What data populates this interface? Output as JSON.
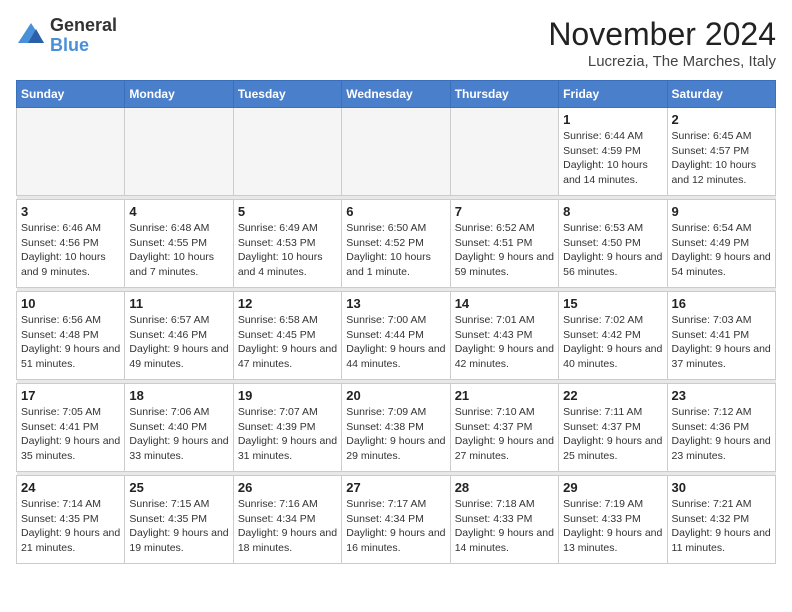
{
  "logo": {
    "general": "General",
    "blue": "Blue"
  },
  "header": {
    "month": "November 2024",
    "location": "Lucrezia, The Marches, Italy"
  },
  "weekdays": [
    "Sunday",
    "Monday",
    "Tuesday",
    "Wednesday",
    "Thursday",
    "Friday",
    "Saturday"
  ],
  "weeks": [
    [
      {
        "day": "",
        "info": ""
      },
      {
        "day": "",
        "info": ""
      },
      {
        "day": "",
        "info": ""
      },
      {
        "day": "",
        "info": ""
      },
      {
        "day": "",
        "info": ""
      },
      {
        "day": "1",
        "info": "Sunrise: 6:44 AM\nSunset: 4:59 PM\nDaylight: 10 hours and 14 minutes."
      },
      {
        "day": "2",
        "info": "Sunrise: 6:45 AM\nSunset: 4:57 PM\nDaylight: 10 hours and 12 minutes."
      }
    ],
    [
      {
        "day": "3",
        "info": "Sunrise: 6:46 AM\nSunset: 4:56 PM\nDaylight: 10 hours and 9 minutes."
      },
      {
        "day": "4",
        "info": "Sunrise: 6:48 AM\nSunset: 4:55 PM\nDaylight: 10 hours and 7 minutes."
      },
      {
        "day": "5",
        "info": "Sunrise: 6:49 AM\nSunset: 4:53 PM\nDaylight: 10 hours and 4 minutes."
      },
      {
        "day": "6",
        "info": "Sunrise: 6:50 AM\nSunset: 4:52 PM\nDaylight: 10 hours and 1 minute."
      },
      {
        "day": "7",
        "info": "Sunrise: 6:52 AM\nSunset: 4:51 PM\nDaylight: 9 hours and 59 minutes."
      },
      {
        "day": "8",
        "info": "Sunrise: 6:53 AM\nSunset: 4:50 PM\nDaylight: 9 hours and 56 minutes."
      },
      {
        "day": "9",
        "info": "Sunrise: 6:54 AM\nSunset: 4:49 PM\nDaylight: 9 hours and 54 minutes."
      }
    ],
    [
      {
        "day": "10",
        "info": "Sunrise: 6:56 AM\nSunset: 4:48 PM\nDaylight: 9 hours and 51 minutes."
      },
      {
        "day": "11",
        "info": "Sunrise: 6:57 AM\nSunset: 4:46 PM\nDaylight: 9 hours and 49 minutes."
      },
      {
        "day": "12",
        "info": "Sunrise: 6:58 AM\nSunset: 4:45 PM\nDaylight: 9 hours and 47 minutes."
      },
      {
        "day": "13",
        "info": "Sunrise: 7:00 AM\nSunset: 4:44 PM\nDaylight: 9 hours and 44 minutes."
      },
      {
        "day": "14",
        "info": "Sunrise: 7:01 AM\nSunset: 4:43 PM\nDaylight: 9 hours and 42 minutes."
      },
      {
        "day": "15",
        "info": "Sunrise: 7:02 AM\nSunset: 4:42 PM\nDaylight: 9 hours and 40 minutes."
      },
      {
        "day": "16",
        "info": "Sunrise: 7:03 AM\nSunset: 4:41 PM\nDaylight: 9 hours and 37 minutes."
      }
    ],
    [
      {
        "day": "17",
        "info": "Sunrise: 7:05 AM\nSunset: 4:41 PM\nDaylight: 9 hours and 35 minutes."
      },
      {
        "day": "18",
        "info": "Sunrise: 7:06 AM\nSunset: 4:40 PM\nDaylight: 9 hours and 33 minutes."
      },
      {
        "day": "19",
        "info": "Sunrise: 7:07 AM\nSunset: 4:39 PM\nDaylight: 9 hours and 31 minutes."
      },
      {
        "day": "20",
        "info": "Sunrise: 7:09 AM\nSunset: 4:38 PM\nDaylight: 9 hours and 29 minutes."
      },
      {
        "day": "21",
        "info": "Sunrise: 7:10 AM\nSunset: 4:37 PM\nDaylight: 9 hours and 27 minutes."
      },
      {
        "day": "22",
        "info": "Sunrise: 7:11 AM\nSunset: 4:37 PM\nDaylight: 9 hours and 25 minutes."
      },
      {
        "day": "23",
        "info": "Sunrise: 7:12 AM\nSunset: 4:36 PM\nDaylight: 9 hours and 23 minutes."
      }
    ],
    [
      {
        "day": "24",
        "info": "Sunrise: 7:14 AM\nSunset: 4:35 PM\nDaylight: 9 hours and 21 minutes."
      },
      {
        "day": "25",
        "info": "Sunrise: 7:15 AM\nSunset: 4:35 PM\nDaylight: 9 hours and 19 minutes."
      },
      {
        "day": "26",
        "info": "Sunrise: 7:16 AM\nSunset: 4:34 PM\nDaylight: 9 hours and 18 minutes."
      },
      {
        "day": "27",
        "info": "Sunrise: 7:17 AM\nSunset: 4:34 PM\nDaylight: 9 hours and 16 minutes."
      },
      {
        "day": "28",
        "info": "Sunrise: 7:18 AM\nSunset: 4:33 PM\nDaylight: 9 hours and 14 minutes."
      },
      {
        "day": "29",
        "info": "Sunrise: 7:19 AM\nSunset: 4:33 PM\nDaylight: 9 hours and 13 minutes."
      },
      {
        "day": "30",
        "info": "Sunrise: 7:21 AM\nSunset: 4:32 PM\nDaylight: 9 hours and 11 minutes."
      }
    ]
  ]
}
